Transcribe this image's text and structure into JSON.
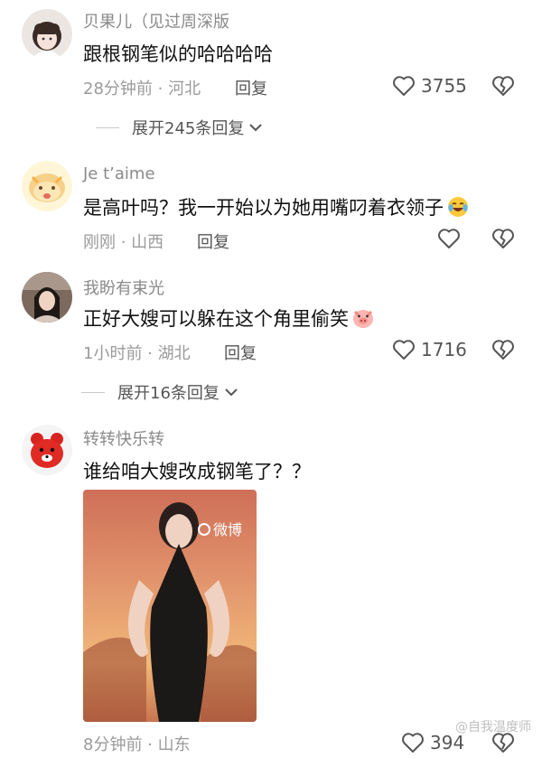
{
  "comments": [
    {
      "username": "贝果儿（见过周深版",
      "text": "跟根钢笔似的哈哈哈哈",
      "meta": "28分钟前 · 河北",
      "reply_label": "回复",
      "likes": "3755",
      "expand_label": "展开245条回复",
      "avatar_icon": "girl-avatar-icon"
    },
    {
      "username": "Je t’aime",
      "text": "是高叶吗？我一开始以为她用嘴叼着衣领子",
      "emoji": "laughing-tears-emoji-icon",
      "meta": "刚刚 · 山西",
      "reply_label": "回复",
      "likes": "",
      "avatar_icon": "cartoon-character-avatar-icon"
    },
    {
      "username": "我盼有束光",
      "text": "正好大嫂可以躲在这个角里偷笑",
      "emoji": "pig-emoji-icon",
      "meta": "1小时前 · 湖北",
      "reply_label": "回复",
      "likes": "1716",
      "expand_label": "展开16条回复",
      "avatar_icon": "girl-photo-avatar-icon"
    },
    {
      "username": "转转快乐转",
      "text": "谁给咱大嫂改成钢笔了？？",
      "meta": "8分钟前 · 山东",
      "reply_label": "",
      "likes": "394",
      "image_text": "微博",
      "avatar_icon": "red-cartoon-bear-avatar-icon"
    }
  ],
  "watermark": "@自我温度师",
  "colors": {
    "primary_text": "#111111",
    "secondary_text": "#8a8a8a",
    "meta_text": "#9a9a9a",
    "icon_gray": "#555555"
  }
}
